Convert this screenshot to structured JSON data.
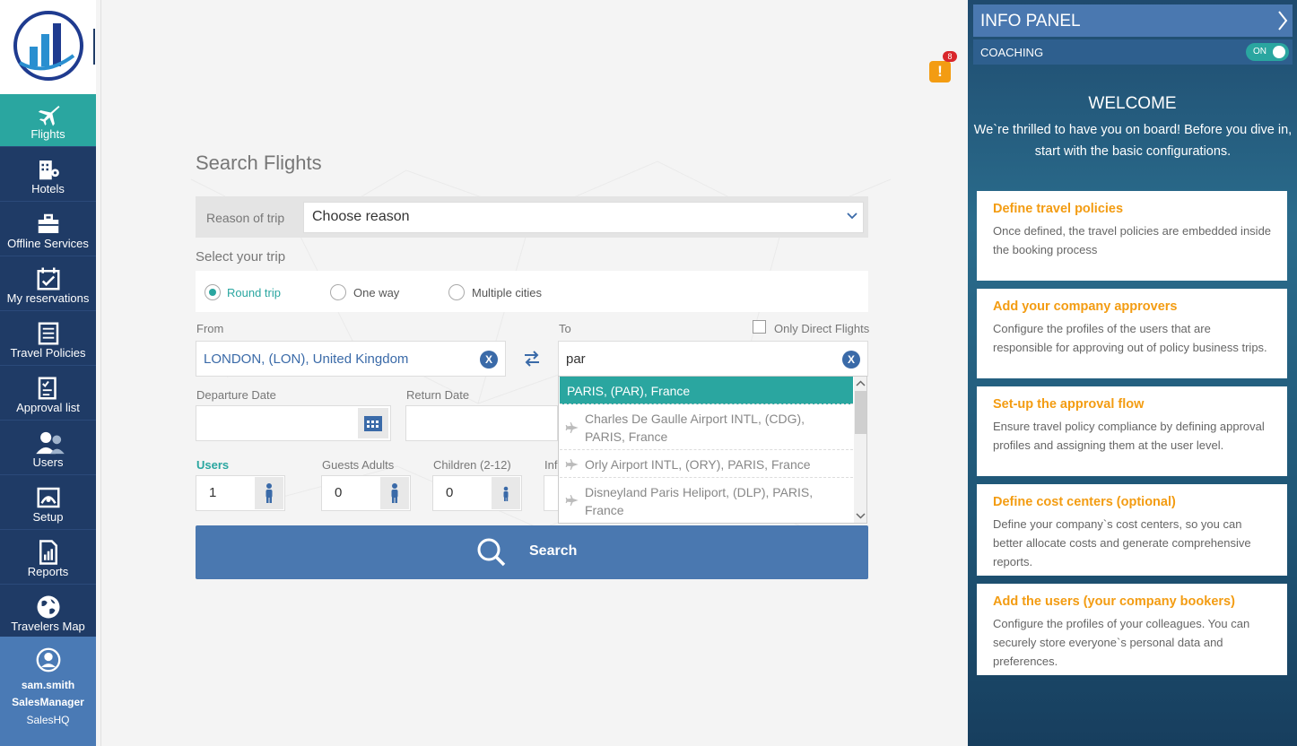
{
  "sidebar": {
    "items": [
      {
        "label": "Flights",
        "icon": "airplane-icon",
        "active": true
      },
      {
        "label": "Hotels",
        "icon": "hotel-icon"
      },
      {
        "label": "Offline Services",
        "icon": "briefcase-icon"
      },
      {
        "label": "My reservations",
        "icon": "calendar-check-icon"
      },
      {
        "label": "Travel Policies",
        "icon": "document-icon"
      },
      {
        "label": "Approval list",
        "icon": "checklist-icon"
      },
      {
        "label": "Users",
        "icon": "users-icon"
      },
      {
        "label": "Setup",
        "icon": "setup-icon"
      },
      {
        "label": "Reports",
        "icon": "report-icon"
      },
      {
        "label": "Travelers Map",
        "icon": "globe-icon"
      }
    ],
    "user": {
      "name": "sam.smith",
      "role": "SalesManager",
      "office": "SalesHQ"
    }
  },
  "alert": {
    "count": "8",
    "symbol": "!"
  },
  "search": {
    "title": "Search Flights",
    "reason_label": "Reason of trip",
    "reason_value": "Choose reason",
    "select_trip_label": "Select your trip",
    "trip_options": [
      "Round trip",
      "One way",
      "Multiple cities"
    ],
    "from_label": "From",
    "from_value": "LONDON, (LON), United Kingdom",
    "to_label": "To",
    "to_value": "par",
    "only_direct_label": "Only Direct Flights",
    "departure_label": "Departure Date",
    "return_label": "Return Date",
    "users_label": "Users",
    "users_value": "1",
    "guests_label": "Guests Adults",
    "guests_value": "0",
    "children_label": "Children (2-12)",
    "children_value": "0",
    "infants_label": "Inf",
    "search_label": "Search",
    "clear_symbol": "X"
  },
  "dropdown": {
    "items": [
      "PARIS, (PAR), France",
      "Charles De Gaulle Airport INTL, (CDG), PARIS, France",
      "Orly Airport INTL, (ORY), PARIS, France",
      "Disneyland Paris Heliport, (DLP), PARIS, France"
    ]
  },
  "info_panel": {
    "title": "INFO PANEL",
    "coaching_label": "COACHING",
    "toggle_label": "ON",
    "welcome_title": "WELCOME",
    "welcome_text": "We`re thrilled to have you on board! Before you dive in, start with the basic configurations.",
    "cards": [
      {
        "title": "Define travel policies",
        "desc": "Once defined, the travel policies are embedded inside the booking process"
      },
      {
        "title": "Add your company approvers",
        "desc": "Configure the profiles of the users that are responsible for approving out of policy business trips."
      },
      {
        "title": "Set-up the approval flow",
        "desc": "Ensure travel policy compliance by defining approval profiles and assigning them at the user level."
      },
      {
        "title": "Define cost centers (optional)",
        "desc": "Define your company`s cost centers, so you can better allocate costs and generate comprehensive reports."
      },
      {
        "title": "Add the users (your company bookers)",
        "desc": "Configure the profiles of your colleagues. You can securely store everyone`s personal data and preferences."
      }
    ]
  },
  "colors": {
    "teal": "#2aa6a0",
    "navy": "#1f3b66",
    "blue": "#4a78b0",
    "orange": "#f39c12"
  }
}
